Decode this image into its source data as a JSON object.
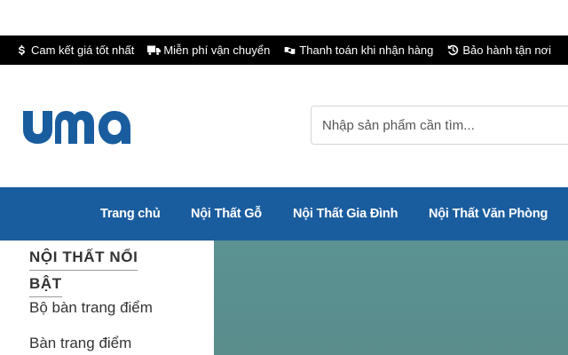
{
  "topbar": {
    "items": [
      {
        "icon": "dollar-icon",
        "label": "Cam kết giá tốt nhất"
      },
      {
        "icon": "truck-icon",
        "label": "Miễn phí vận chuyển"
      },
      {
        "icon": "cash-icon",
        "label": "Thanh toán khi nhận hàng"
      },
      {
        "icon": "history-icon",
        "label": "Bảo hành tận nơi"
      }
    ]
  },
  "header": {
    "logo_text": "uma",
    "search_placeholder": "Nhập sản phẩm cần tìm..."
  },
  "nav": {
    "items": [
      "Trang chủ",
      "Nội Thất Gỗ",
      "Nội Thất Gia Đình",
      "Nội Thất Văn Phòng"
    ]
  },
  "sidebar": {
    "heading_line1": "NỘI THẤT NỔI",
    "heading_line2": "BẬT",
    "items": [
      "Bộ bàn trang điểm",
      "Bàn trang điểm"
    ]
  },
  "colors": {
    "topbar_bg": "#000000",
    "nav_bg": "#1a5d9f",
    "logo": "#1a5d9f",
    "banner": "#5a8f8f"
  }
}
